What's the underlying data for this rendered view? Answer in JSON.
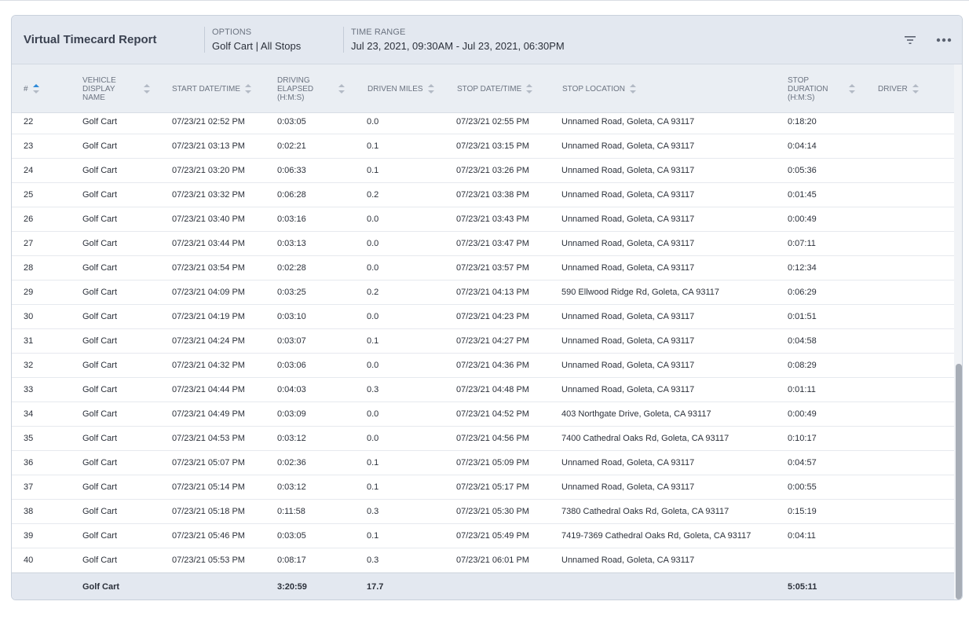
{
  "report": {
    "title": "Virtual Timecard Report",
    "options_label": "OPTIONS",
    "options_value": "Golf Cart | All Stops",
    "time_range_label": "TIME RANGE",
    "time_range_value": "Jul 23, 2021, 09:30AM - Jul 23, 2021, 06:30PM",
    "filter_icon": "filter-icon",
    "more_icon": "more-options-icon"
  },
  "columns": [
    {
      "key": "num",
      "label": "#",
      "sort": "asc"
    },
    {
      "key": "vehicle",
      "label": "VEHICLE DISPLAY NAME",
      "sort": "none"
    },
    {
      "key": "start",
      "label": "START DATE/TIME",
      "sort": "none"
    },
    {
      "key": "elapsed",
      "label": "DRIVING ELAPSED (H:M:S)",
      "sort": "none"
    },
    {
      "key": "miles",
      "label": "DRIVEN MILES",
      "sort": "none"
    },
    {
      "key": "stop",
      "label": "STOP DATE/TIME",
      "sort": "none"
    },
    {
      "key": "location",
      "label": "STOP LOCATION",
      "sort": "none"
    },
    {
      "key": "duration",
      "label": "STOP DURATION (H:M:S)",
      "sort": "none"
    },
    {
      "key": "driver",
      "label": "DRIVER",
      "sort": "none"
    }
  ],
  "rows": [
    {
      "num": "22",
      "vehicle": "Golf Cart",
      "start": "07/23/21 02:52 PM",
      "elapsed": "0:03:05",
      "miles": "0.0",
      "stop": "07/23/21 02:55 PM",
      "location": "Unnamed Road, Goleta, CA 93117",
      "duration": "0:18:20",
      "driver": ""
    },
    {
      "num": "23",
      "vehicle": "Golf Cart",
      "start": "07/23/21 03:13 PM",
      "elapsed": "0:02:21",
      "miles": "0.1",
      "stop": "07/23/21 03:15 PM",
      "location": "Unnamed Road, Goleta, CA 93117",
      "duration": "0:04:14",
      "driver": ""
    },
    {
      "num": "24",
      "vehicle": "Golf Cart",
      "start": "07/23/21 03:20 PM",
      "elapsed": "0:06:33",
      "miles": "0.1",
      "stop": "07/23/21 03:26 PM",
      "location": "Unnamed Road, Goleta, CA 93117",
      "duration": "0:05:36",
      "driver": ""
    },
    {
      "num": "25",
      "vehicle": "Golf Cart",
      "start": "07/23/21 03:32 PM",
      "elapsed": "0:06:28",
      "miles": "0.2",
      "stop": "07/23/21 03:38 PM",
      "location": "Unnamed Road, Goleta, CA 93117",
      "duration": "0:01:45",
      "driver": ""
    },
    {
      "num": "26",
      "vehicle": "Golf Cart",
      "start": "07/23/21 03:40 PM",
      "elapsed": "0:03:16",
      "miles": "0.0",
      "stop": "07/23/21 03:43 PM",
      "location": "Unnamed Road, Goleta, CA 93117",
      "duration": "0:00:49",
      "driver": ""
    },
    {
      "num": "27",
      "vehicle": "Golf Cart",
      "start": "07/23/21 03:44 PM",
      "elapsed": "0:03:13",
      "miles": "0.0",
      "stop": "07/23/21 03:47 PM",
      "location": "Unnamed Road, Goleta, CA 93117",
      "duration": "0:07:11",
      "driver": ""
    },
    {
      "num": "28",
      "vehicle": "Golf Cart",
      "start": "07/23/21 03:54 PM",
      "elapsed": "0:02:28",
      "miles": "0.0",
      "stop": "07/23/21 03:57 PM",
      "location": "Unnamed Road, Goleta, CA 93117",
      "duration": "0:12:34",
      "driver": ""
    },
    {
      "num": "29",
      "vehicle": "Golf Cart",
      "start": "07/23/21 04:09 PM",
      "elapsed": "0:03:25",
      "miles": "0.2",
      "stop": "07/23/21 04:13 PM",
      "location": "590 Ellwood Ridge Rd, Goleta, CA 93117",
      "duration": "0:06:29",
      "driver": ""
    },
    {
      "num": "30",
      "vehicle": "Golf Cart",
      "start": "07/23/21 04:19 PM",
      "elapsed": "0:03:10",
      "miles": "0.0",
      "stop": "07/23/21 04:23 PM",
      "location": "Unnamed Road, Goleta, CA 93117",
      "duration": "0:01:51",
      "driver": ""
    },
    {
      "num": "31",
      "vehicle": "Golf Cart",
      "start": "07/23/21 04:24 PM",
      "elapsed": "0:03:07",
      "miles": "0.1",
      "stop": "07/23/21 04:27 PM",
      "location": "Unnamed Road, Goleta, CA 93117",
      "duration": "0:04:58",
      "driver": ""
    },
    {
      "num": "32",
      "vehicle": "Golf Cart",
      "start": "07/23/21 04:32 PM",
      "elapsed": "0:03:06",
      "miles": "0.0",
      "stop": "07/23/21 04:36 PM",
      "location": "Unnamed Road, Goleta, CA 93117",
      "duration": "0:08:29",
      "driver": ""
    },
    {
      "num": "33",
      "vehicle": "Golf Cart",
      "start": "07/23/21 04:44 PM",
      "elapsed": "0:04:03",
      "miles": "0.3",
      "stop": "07/23/21 04:48 PM",
      "location": "Unnamed Road, Goleta, CA 93117",
      "duration": "0:01:11",
      "driver": ""
    },
    {
      "num": "34",
      "vehicle": "Golf Cart",
      "start": "07/23/21 04:49 PM",
      "elapsed": "0:03:09",
      "miles": "0.0",
      "stop": "07/23/21 04:52 PM",
      "location": "403 Northgate Drive, Goleta, CA 93117",
      "duration": "0:00:49",
      "driver": ""
    },
    {
      "num": "35",
      "vehicle": "Golf Cart",
      "start": "07/23/21 04:53 PM",
      "elapsed": "0:03:12",
      "miles": "0.0",
      "stop": "07/23/21 04:56 PM",
      "location": "7400 Cathedral Oaks Rd, Goleta, CA 93117",
      "duration": "0:10:17",
      "driver": ""
    },
    {
      "num": "36",
      "vehicle": "Golf Cart",
      "start": "07/23/21 05:07 PM",
      "elapsed": "0:02:36",
      "miles": "0.1",
      "stop": "07/23/21 05:09 PM",
      "location": "Unnamed Road, Goleta, CA 93117",
      "duration": "0:04:57",
      "driver": ""
    },
    {
      "num": "37",
      "vehicle": "Golf Cart",
      "start": "07/23/21 05:14 PM",
      "elapsed": "0:03:12",
      "miles": "0.1",
      "stop": "07/23/21 05:17 PM",
      "location": "Unnamed Road, Goleta, CA 93117",
      "duration": "0:00:55",
      "driver": ""
    },
    {
      "num": "38",
      "vehicle": "Golf Cart",
      "start": "07/23/21 05:18 PM",
      "elapsed": "0:11:58",
      "miles": "0.3",
      "stop": "07/23/21 05:30 PM",
      "location": "7380 Cathedral Oaks Rd, Goleta, CA 93117",
      "duration": "0:15:19",
      "driver": ""
    },
    {
      "num": "39",
      "vehicle": "Golf Cart",
      "start": "07/23/21 05:46 PM",
      "elapsed": "0:03:05",
      "miles": "0.1",
      "stop": "07/23/21 05:49 PM",
      "location": "7419-7369 Cathedral Oaks Rd, Goleta, CA 93117",
      "duration": "0:04:11",
      "driver": ""
    },
    {
      "num": "40",
      "vehicle": "Golf Cart",
      "start": "07/23/21 05:53 PM",
      "elapsed": "0:08:17",
      "miles": "0.3",
      "stop": "07/23/21 06:01 PM",
      "location": "Unnamed Road, Goleta, CA 93117",
      "duration": "",
      "driver": ""
    }
  ],
  "totals": {
    "vehicle": "Golf Cart",
    "elapsed": "3:20:59",
    "miles": "17.7",
    "duration": "5:05:11"
  },
  "colors": {
    "header_bg": "#e3e8f0",
    "sort_active": "#2e8ad8"
  }
}
